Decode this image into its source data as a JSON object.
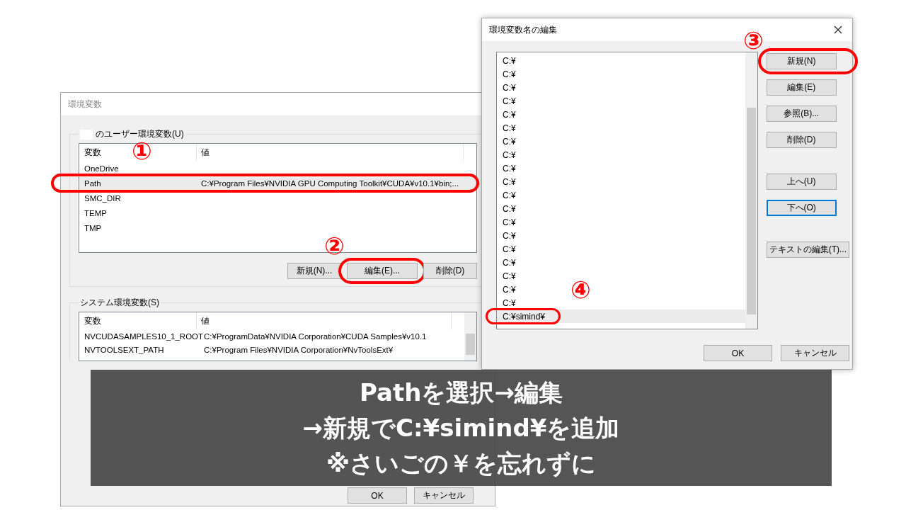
{
  "env_dialog": {
    "title": "環境変数",
    "user_group": {
      "label": "のユーザー環境変数(U)",
      "columns": [
        "変数",
        "値"
      ],
      "rows": [
        {
          "name": "OneDrive",
          "selected": false
        },
        {
          "name": "Path",
          "value": "C:¥Program Files¥NVIDIA GPU Computing Toolkit¥CUDA¥v10.1¥bin;...",
          "selected": true
        },
        {
          "name": "SMC_DIR",
          "selected": false
        },
        {
          "name": "TEMP",
          "selected": false
        },
        {
          "name": "TMP",
          "selected": false
        }
      ],
      "buttons": [
        "新規(N)...",
        "編集(E)...",
        "削除(D)"
      ]
    },
    "system_group": {
      "label": "システム環境変数(S)",
      "columns": [
        "変数",
        "値"
      ],
      "rows": [
        {
          "name": "NVCUDASAMPLES10_1_ROOT",
          "value": "C:¥ProgramData¥NVIDIA Corporation¥CUDA Samples¥v10.1",
          "selected": false
        },
        {
          "name": "NVTOOLSEXT_PATH",
          "value": "C:¥Program Files¥NVIDIA Corporation¥NvToolsExt¥",
          "selected": false
        }
      ]
    },
    "buttons": [
      "OK",
      "キャンセル"
    ]
  },
  "edit_dialog": {
    "title": "環境変数名の編集",
    "items": [
      {
        "text": "C:¥",
        "selected": false
      },
      {
        "text": "C:¥",
        "selected": false
      },
      {
        "text": "C:¥",
        "selected": false
      },
      {
        "text": "C:¥",
        "selected": false
      },
      {
        "text": "C:¥",
        "selected": false
      },
      {
        "text": "C:¥",
        "selected": false
      },
      {
        "text": "C:¥",
        "selected": false
      },
      {
        "text": "C:¥",
        "selected": false
      },
      {
        "text": "C:¥",
        "selected": false
      },
      {
        "text": "C:¥",
        "selected": false
      },
      {
        "text": "C:¥",
        "selected": false
      },
      {
        "text": "C:¥",
        "selected": false
      },
      {
        "text": "C:¥",
        "selected": false
      },
      {
        "text": "C:¥",
        "selected": false
      },
      {
        "text": "C:¥",
        "selected": false
      },
      {
        "text": "C:¥",
        "selected": false
      },
      {
        "text": "C:¥",
        "selected": false
      },
      {
        "text": "C:¥",
        "selected": false
      },
      {
        "text": "C:¥",
        "selected": false
      },
      {
        "text": "C:¥simind¥",
        "selected": true
      }
    ],
    "button_groups": [
      [
        {
          "label": "新規(N)",
          "focused": false
        },
        {
          "label": "編集(E)",
          "focused": false
        },
        {
          "label": "参照(B)...",
          "focused": false
        },
        {
          "label": "削除(D)",
          "focused": false
        }
      ],
      [
        {
          "label": "上へ(U)",
          "focused": false
        },
        {
          "label": "下へ(O)",
          "focused": true
        }
      ],
      [
        {
          "label": "テキストの編集(T)...",
          "focused": false
        }
      ]
    ],
    "buttons": [
      "OK",
      "キャンセル"
    ]
  },
  "annotations": [
    {
      "label": "①"
    },
    {
      "label": "②"
    },
    {
      "label": "③"
    },
    {
      "label": "④"
    }
  ],
  "caption": [
    "Pathを選択→編集",
    "→新規でC:¥simind¥を追加",
    "※さいごの￥を忘れずに"
  ]
}
